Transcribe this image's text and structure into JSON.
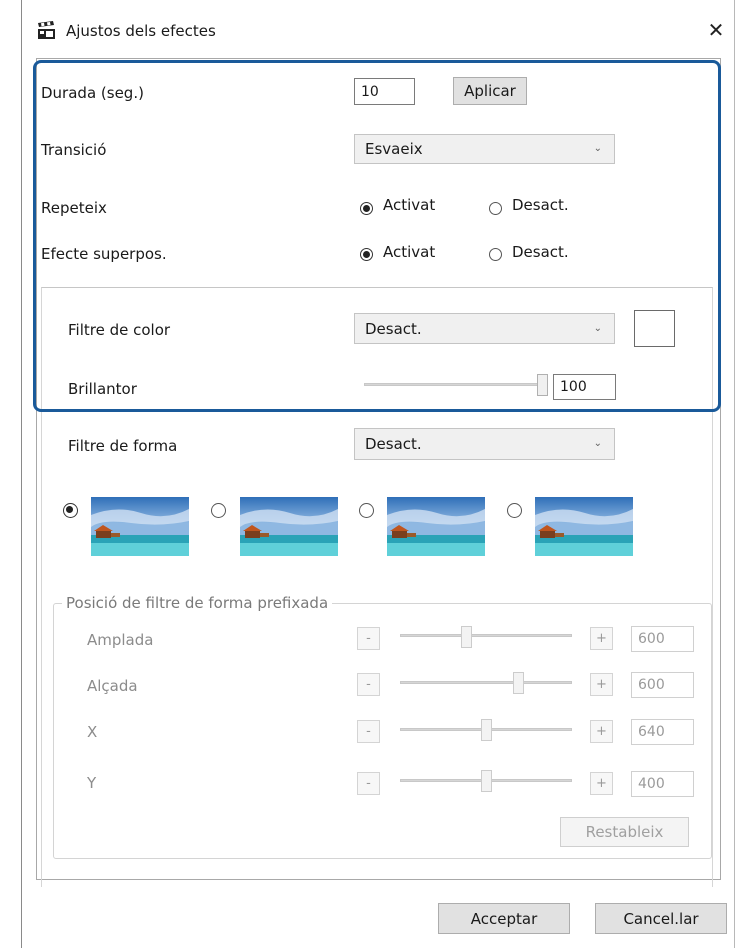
{
  "window": {
    "title": "Ajustos dels efectes",
    "close_glyph": "✕"
  },
  "duration": {
    "label": "Durada (seg.)",
    "value": "10",
    "apply_label": "Aplicar"
  },
  "transition": {
    "label": "Transició",
    "value": "Esvaeix"
  },
  "repeat": {
    "label": "Repeteix",
    "on_label": "Activat",
    "off_label": "Desact.",
    "selected": "on"
  },
  "overlay": {
    "label": "Efecte superpos.",
    "on_label": "Activat",
    "off_label": "Desact.",
    "selected": "on"
  },
  "color_filter": {
    "label": "Filtre de color",
    "value": "Desact."
  },
  "brightness": {
    "label": "Brillantor",
    "value": "100"
  },
  "shape_filter": {
    "label": "Filtre de forma",
    "value": "Desact.",
    "selected_index": 0
  },
  "preset": {
    "group_label": "Posició de filtre de forma prefixada",
    "minus_label": "-",
    "plus_label": "+",
    "rows": [
      {
        "label": "Amplada",
        "value": "600"
      },
      {
        "label": "Alçada",
        "value": "600"
      },
      {
        "label": "X",
        "value": "640"
      },
      {
        "label": "Y",
        "value": "400"
      }
    ],
    "reset_label": "Restableix"
  },
  "footer": {
    "ok_label": "Acceptar",
    "cancel_label": "Cancel.lar"
  },
  "colors": {
    "highlight": "#1a5a9a",
    "accent": "#005a9e"
  }
}
